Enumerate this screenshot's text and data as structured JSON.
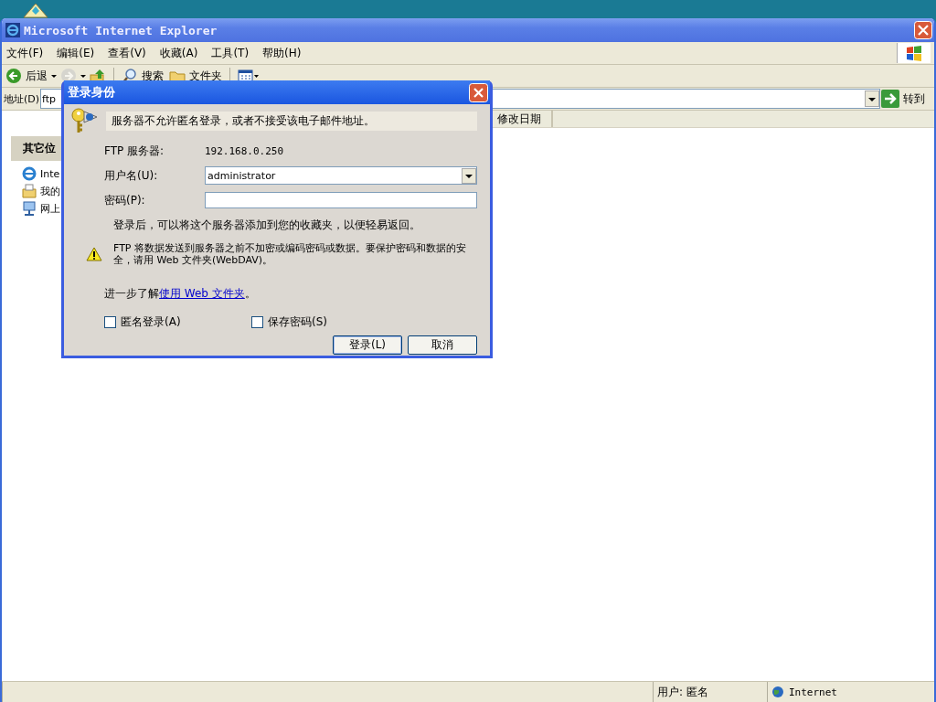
{
  "window": {
    "title": "Microsoft Internet Explorer"
  },
  "menu": [
    "文件(F)",
    "编辑(E)",
    "查看(V)",
    "收藏(A)",
    "工具(T)",
    "帮助(H)"
  ],
  "toolbar": [
    {
      "kind": "back",
      "label": "后退",
      "disabled": false
    },
    {
      "kind": "forward",
      "disabled": true
    },
    {
      "kind": "up",
      "disabled": false
    },
    {
      "kind": "search",
      "label": "搜索",
      "disabled": false
    },
    {
      "kind": "folders",
      "label": "文件夹",
      "disabled": false
    },
    {
      "kind": "views",
      "disabled": false
    }
  ],
  "address": {
    "label": "地址(D)",
    "value": "ftp",
    "go": "转到"
  },
  "tasks": {
    "title": "其它位",
    "items": [
      {
        "kind": "ie",
        "label": "Inte"
      },
      {
        "kind": "documents",
        "label": "我的"
      },
      {
        "kind": "network",
        "label": "网上"
      }
    ]
  },
  "file_list": {
    "columns": [
      "修改日期"
    ]
  },
  "status_bar": {
    "user": "用户: 匿名",
    "zone": "Internet"
  },
  "dialog": {
    "title": "登录身份",
    "message": "服务器不允许匿名登录，或者不接受该电子邮件地址。",
    "server_label": "FTP 服务器:",
    "server": "192.168.0.250",
    "username_label": "用户名(U):",
    "username": "administrator",
    "password_label": "密码(P):",
    "info": "登录后，可以将这个服务器添加到您的收藏夹，以便轻易返回。",
    "warning": "FTP 将数据发送到服务器之前不加密或编码密码或数据。要保护密码和数据的安全，请用 Web 文件夹(WebDAV)。",
    "learn_more": {
      "before": "进一步了解",
      "link": "使用 Web 文件夹",
      "after": "。"
    },
    "checkboxes": [
      {
        "label": "匿名登录(A)",
        "checked": false
      },
      {
        "label": "保存密码(S)",
        "checked": false
      }
    ],
    "buttons": [
      {
        "label": "登录(L)",
        "default": true
      },
      {
        "label": "取消",
        "default": false
      }
    ]
  }
}
